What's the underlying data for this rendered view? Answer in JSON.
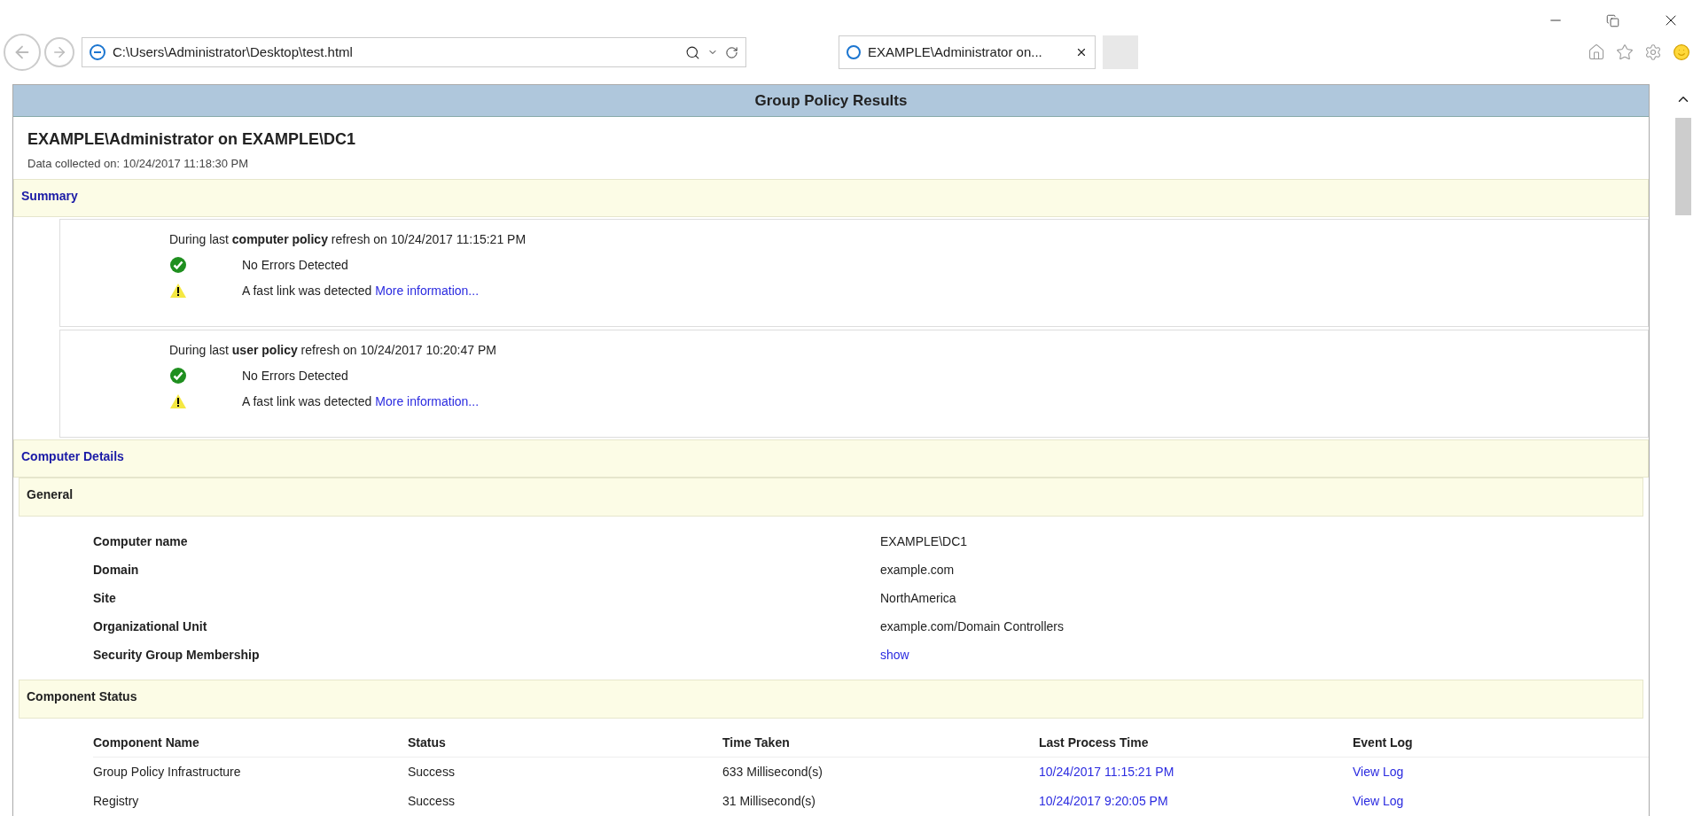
{
  "browser": {
    "address": "C:\\Users\\Administrator\\Desktop\\test.html",
    "tabs": [
      {
        "title": "EXAMPLE\\Administrator on...",
        "selected": true
      }
    ]
  },
  "report": {
    "header": "Group Policy Results",
    "title": "EXAMPLE\\Administrator on EXAMPLE\\DC1",
    "collected": "Data collected on: 10/24/2017 11:18:30 PM"
  },
  "summary": {
    "heading": "Summary",
    "blocks": [
      {
        "intro": "During last **computer policy** refresh on 10/24/2017 11:15:21 PM",
        "items": [
          {
            "kind": "ok",
            "text": "No Errors Detected"
          },
          {
            "kind": "warning",
            "text": "A fast link was detected",
            "link": "More information..."
          }
        ]
      },
      {
        "intro": "During last **user policy** refresh on 10/24/2017 10:20:47 PM",
        "items": [
          {
            "kind": "ok",
            "text": "No Errors Detected"
          },
          {
            "kind": "warning",
            "text": "A fast link was detected",
            "link": "More information..."
          }
        ]
      }
    ]
  },
  "computer_details": {
    "heading": "Computer Details",
    "general": {
      "heading": "General",
      "rows": [
        {
          "label": "Computer name",
          "value": "EXAMPLE\\DC1",
          "kind": "text"
        },
        {
          "label": "Domain",
          "value": "example.com",
          "kind": "text"
        },
        {
          "label": "Site",
          "value": "NorthAmerica",
          "kind": "text"
        },
        {
          "label": "Organizational Unit",
          "value": "example.com/Domain Controllers",
          "kind": "text"
        },
        {
          "label": "Security Group Membership",
          "value": "show",
          "kind": "link"
        }
      ]
    },
    "component_status": {
      "heading": "Component Status",
      "columns": [
        "Component Name",
        "Status",
        "Time Taken",
        "Last Process Time",
        "Event Log"
      ],
      "rows": [
        [
          "Group Policy Infrastructure",
          "Success",
          "633 Millisecond(s)",
          "10/24/2017 11:15:21 PM",
          "View Log"
        ],
        [
          "Registry",
          "Success",
          "31 Millisecond(s)",
          "10/24/2017 9:20:05 PM",
          "View Log"
        ]
      ]
    }
  }
}
